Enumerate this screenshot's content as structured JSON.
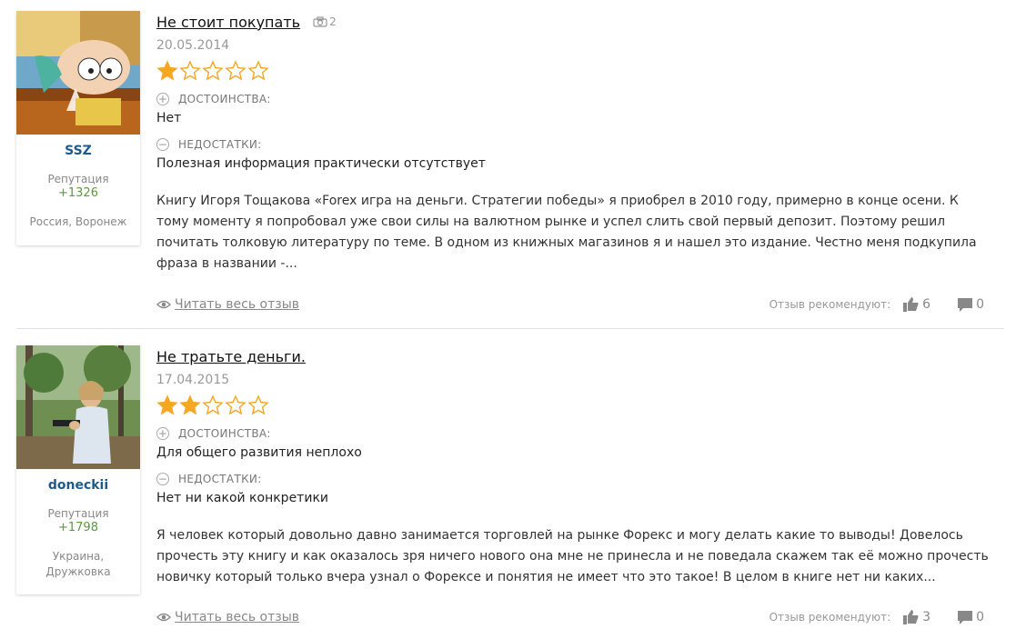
{
  "reviews": [
    {
      "user": {
        "name": "SSZ",
        "reputation_label": "Репутация",
        "reputation": "+1326",
        "location": "Россия, Воронеж",
        "avatar_icon": "cartoon-baby-avatar"
      },
      "title": "Не стоит покупать",
      "photos_count": "2",
      "date": "20.05.2014",
      "rating": 1,
      "rating_max": 5,
      "pros_label": "ДОСТОИНСТВА:",
      "pros": "Нет",
      "cons_label": "НЕДОСТАТКИ:",
      "cons": "Полезная информация практически отсутствует",
      "text": "Книгу Игоря Тощакова «Forex игра на деньги. Стратегии победы» я приобрел в 2010 году, примерно в конце осени. К тому моменту я попробовал уже свои силы на валютном рынке и успел слить свой первый депозит. Поэтому решил почитать толковую литературу по теме. В одном из книжных магазинов я и нашел это издание. Честно меня подкупила фраза в названии -...",
      "read_more": "Читать весь отзыв",
      "recommend_label": "Отзыв рекомендуют:",
      "likes": "6",
      "comments": "0"
    },
    {
      "user": {
        "name": "doneckii",
        "reputation_label": "Репутация",
        "reputation": "+1798",
        "location": "Украина, Дружковка",
        "avatar_icon": "man-with-gun-photo-avatar"
      },
      "title": "Не тратьте деньги.",
      "photos_count": "",
      "date": "17.04.2015",
      "rating": 2,
      "rating_max": 5,
      "pros_label": "ДОСТОИНСТВА:",
      "pros": "Для общего развития неплохо",
      "cons_label": "НЕДОСТАТКИ:",
      "cons": "Нет ни какой конкретики",
      "text": "Я человек который довольно давно занимается торговлей на рынке Форекс и могу делать какие то выводы! Довелось прочесть эту книгу и как оказалось зря ничего нового она мне не принесла и не поведала скажем так её можно прочесть новичку который только вчера узнал о Форексе и понятия не имеет что это такое! В целом в книге нет ни каких...",
      "read_more": "Читать весь отзыв",
      "recommend_label": "Отзыв рекомендуют:",
      "likes": "3",
      "comments": "0"
    }
  ],
  "colors": {
    "star": "#f5a623",
    "username": "#1f5a8a",
    "reputation": "#5a9a3a"
  }
}
